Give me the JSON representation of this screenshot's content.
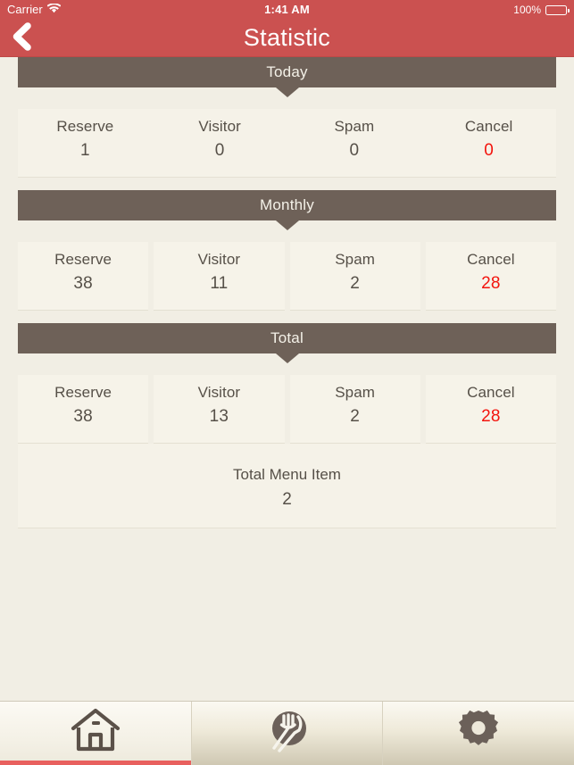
{
  "status_bar": {
    "carrier": "Carrier",
    "wifi_icon": "wifi-icon",
    "time": "1:41 AM",
    "battery_percent": "100%",
    "battery_icon": "battery-icon"
  },
  "nav": {
    "title": "Statistic",
    "back_icon": "chevron-left-icon"
  },
  "colors": {
    "accent_red": "#CB5150",
    "header_brown": "#6E6158",
    "page_background": "#F1EEE4",
    "cell_background": "#F5F2E8",
    "text": "#565048",
    "danger": "#F3140D",
    "tab_indicator": "#E8605E"
  },
  "sections": [
    {
      "title": "Today",
      "columns": [
        {
          "label": "Reserve",
          "value": "1",
          "danger": false
        },
        {
          "label": "Visitor",
          "value": "0",
          "danger": false
        },
        {
          "label": "Spam",
          "value": "0",
          "danger": false
        },
        {
          "label": "Cancel",
          "value": "0",
          "danger": true
        }
      ]
    },
    {
      "title": "Monthly",
      "columns": [
        {
          "label": "Reserve",
          "value": "38",
          "danger": false
        },
        {
          "label": "Visitor",
          "value": "11",
          "danger": false
        },
        {
          "label": "Spam",
          "value": "2",
          "danger": false
        },
        {
          "label": "Cancel",
          "value": "28",
          "danger": true
        }
      ]
    },
    {
      "title": "Total",
      "columns": [
        {
          "label": "Reserve",
          "value": "38",
          "danger": false
        },
        {
          "label": "Visitor",
          "value": "13",
          "danger": false
        },
        {
          "label": "Spam",
          "value": "2",
          "danger": false
        },
        {
          "label": "Cancel",
          "value": "28",
          "danger": true
        }
      ]
    }
  ],
  "menu_total": {
    "label": "Total Menu Item",
    "value": "2"
  },
  "tabs": [
    {
      "name": "home",
      "icon": "home-icon",
      "active": true
    },
    {
      "name": "menu",
      "icon": "cutlery-icon",
      "active": false
    },
    {
      "name": "settings",
      "icon": "gear-icon",
      "active": false
    }
  ]
}
